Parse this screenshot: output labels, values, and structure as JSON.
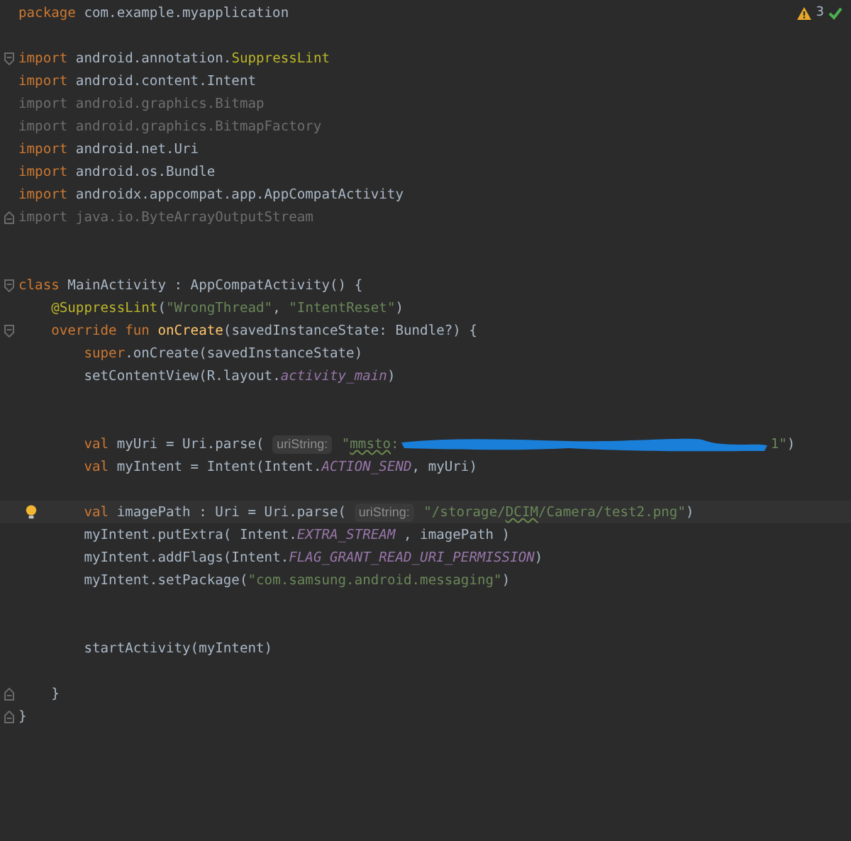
{
  "inspections": {
    "warnings": "3"
  },
  "lines": [
    {
      "kind": "code",
      "tokens": [
        {
          "text": "package",
          "kind": "kw"
        },
        {
          "text": " com.example.myapplication",
          "kind": "plain"
        }
      ]
    },
    {
      "kind": "blank"
    },
    {
      "kind": "code",
      "fold_start": true,
      "tokens": [
        {
          "text": "import",
          "kind": "kw"
        },
        {
          "text": " android.annotation.",
          "kind": "plain"
        },
        {
          "text": "SuppressLint",
          "kind": "ann"
        }
      ]
    },
    {
      "kind": "code",
      "tokens": [
        {
          "text": "import",
          "kind": "kw"
        },
        {
          "text": " android.content.Intent",
          "kind": "plain"
        }
      ]
    },
    {
      "kind": "code",
      "tokens": [
        {
          "text": "import android.graphics.Bitmap",
          "kind": "unused"
        }
      ]
    },
    {
      "kind": "code",
      "tokens": [
        {
          "text": "import android.graphics.BitmapFactory",
          "kind": "unused"
        }
      ]
    },
    {
      "kind": "code",
      "tokens": [
        {
          "text": "import",
          "kind": "kw"
        },
        {
          "text": " android.net.Uri",
          "kind": "plain"
        }
      ]
    },
    {
      "kind": "code",
      "tokens": [
        {
          "text": "import",
          "kind": "kw"
        },
        {
          "text": " android.os.Bundle",
          "kind": "plain"
        }
      ]
    },
    {
      "kind": "code",
      "tokens": [
        {
          "text": "import",
          "kind": "kw"
        },
        {
          "text": " androidx.appcompat.app.AppCompatActivity",
          "kind": "plain"
        }
      ]
    },
    {
      "kind": "code",
      "fold_end": true,
      "tokens": [
        {
          "text": "import java.io.ByteArrayOutputStream",
          "kind": "unused"
        }
      ]
    },
    {
      "kind": "blank"
    },
    {
      "kind": "blank"
    },
    {
      "kind": "code",
      "fold_start": true,
      "tokens": [
        {
          "text": "class",
          "kind": "kw"
        },
        {
          "text": " MainActivity : AppCompatActivity() {",
          "kind": "plain"
        }
      ]
    },
    {
      "kind": "code",
      "tokens": [
        {
          "text": "    @SuppressLint",
          "kind": "ann"
        },
        {
          "text": "(",
          "kind": "plain"
        },
        {
          "text": "\"WrongThread\"",
          "kind": "str"
        },
        {
          "text": ", ",
          "kind": "plain"
        },
        {
          "text": "\"IntentReset\"",
          "kind": "str"
        },
        {
          "text": ")",
          "kind": "plain"
        }
      ]
    },
    {
      "kind": "code",
      "fold_start": true,
      "tokens": [
        {
          "text": "    override fun ",
          "kind": "kw"
        },
        {
          "text": "onCreate",
          "kind": "fn"
        },
        {
          "text": "(savedInstanceState: Bundle?) {",
          "kind": "plain"
        }
      ]
    },
    {
      "kind": "code",
      "tokens": [
        {
          "text": "        super",
          "kind": "kw"
        },
        {
          "text": ".onCreate(savedInstanceState)",
          "kind": "plain"
        }
      ]
    },
    {
      "kind": "code",
      "tokens": [
        {
          "text": "        setContentView(R.layout.",
          "kind": "plain"
        },
        {
          "text": "activity_main",
          "kind": "const"
        },
        {
          "text": ")",
          "kind": "plain"
        }
      ]
    },
    {
      "kind": "blank"
    },
    {
      "kind": "blank"
    },
    {
      "kind": "code",
      "tokens": [
        {
          "text": "        val",
          "kind": "kw"
        },
        {
          "text": " myUri = Uri.parse( ",
          "kind": "plain"
        },
        {
          "text": "uriString:",
          "kind": "hint"
        },
        {
          "text": " \"",
          "kind": "str"
        },
        {
          "text": "mmsto",
          "kind": "str",
          "typo": true
        },
        {
          "text": ":",
          "kind": "str"
        },
        {
          "kind": "redaction"
        },
        {
          "text": "1\"",
          "kind": "str"
        },
        {
          "text": ")",
          "kind": "plain"
        }
      ]
    },
    {
      "kind": "code",
      "tokens": [
        {
          "text": "        val",
          "kind": "kw"
        },
        {
          "text": " myIntent = Intent(Intent.",
          "kind": "plain"
        },
        {
          "text": "ACTION_SEND",
          "kind": "const"
        },
        {
          "text": ", myUri)",
          "kind": "plain"
        }
      ]
    },
    {
      "kind": "blank"
    },
    {
      "kind": "code",
      "bulb": true,
      "current": true,
      "tokens": [
        {
          "text": "        val",
          "kind": "kw"
        },
        {
          "text": " imagePath : Uri = Uri.parse( ",
          "kind": "plain"
        },
        {
          "text": "uriString:",
          "kind": "hint"
        },
        {
          "text": " \"/storage/",
          "kind": "str"
        },
        {
          "text": "DCIM",
          "kind": "str",
          "typo": true
        },
        {
          "text": "/Camera/test2.png\"",
          "kind": "str"
        },
        {
          "text": ")",
          "kind": "plain"
        }
      ]
    },
    {
      "kind": "code",
      "tokens": [
        {
          "text": "        myIntent.putExtra( Intent.",
          "kind": "plain"
        },
        {
          "text": "EXTRA_STREAM",
          "kind": "const"
        },
        {
          "text": " , imagePath )",
          "kind": "plain"
        }
      ]
    },
    {
      "kind": "code",
      "tokens": [
        {
          "text": "        myIntent.addFlags(Intent.",
          "kind": "plain"
        },
        {
          "text": "FLAG_GRANT_READ_URI_PERMISSION",
          "kind": "const"
        },
        {
          "text": ")",
          "kind": "plain"
        }
      ]
    },
    {
      "kind": "code",
      "tokens": [
        {
          "text": "        myIntent.setPackage(",
          "kind": "plain"
        },
        {
          "text": "\"com.samsung.android.messaging\"",
          "kind": "str"
        },
        {
          "text": ")",
          "kind": "plain"
        }
      ]
    },
    {
      "kind": "blank"
    },
    {
      "kind": "blank"
    },
    {
      "kind": "code",
      "tokens": [
        {
          "text": "        startActivity(myIntent)",
          "kind": "plain"
        }
      ]
    },
    {
      "kind": "blank"
    },
    {
      "kind": "code",
      "fold_end": true,
      "tokens": [
        {
          "text": "    }",
          "kind": "plain"
        }
      ]
    },
    {
      "kind": "code",
      "fold_end": true,
      "tokens": [
        {
          "text": "}",
          "kind": "plain"
        }
      ]
    }
  ]
}
